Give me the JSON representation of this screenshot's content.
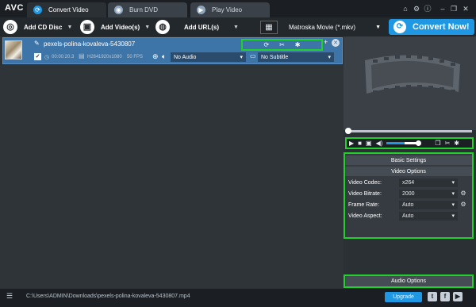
{
  "app": {
    "logo": "AVC"
  },
  "tabs": [
    {
      "label": "Convert Video"
    },
    {
      "label": "Burn DVD"
    },
    {
      "label": "Play Video"
    }
  ],
  "window_buttons": [
    "shop-icon",
    "gear-icon",
    "info-icon",
    "minimize-icon",
    "restore-icon",
    "close-icon"
  ],
  "toolbar": {
    "add_cd": "Add CD Disc",
    "add_video": "Add Video(s)",
    "add_url": "Add URL(s)",
    "format": "Matroska Movie (*.mkv)",
    "convert": "Convert Now!"
  },
  "file": {
    "name": "pexels-polina-kovaleva-5430807",
    "duration": "00:00:20.3",
    "codec": "H264",
    "resolution": "1920x1080",
    "fps": "50 FPS",
    "audio": "No Audio",
    "subtitle": "No Subtitle"
  },
  "player": {
    "volume_percent": 60
  },
  "settings": {
    "basic_header": "Basic Settings",
    "video_header": "Video Options",
    "rows": [
      {
        "label": "Video Codec:",
        "value": "x264"
      },
      {
        "label": "Video Bitrate:",
        "value": "2000"
      },
      {
        "label": "Frame Rate:",
        "value": "Auto"
      },
      {
        "label": "Video Aspect:",
        "value": "Auto"
      }
    ],
    "audio_header": "Audio Options"
  },
  "status": {
    "path": "C:\\Users\\ADMIN\\Downloads\\pexels-polina-kovaleva-5430807.mp4",
    "upgrade": "Upgrade"
  },
  "colors": {
    "accent": "#1f97e3",
    "highlight": "#22d02c",
    "selected_row": "#3d75a8"
  }
}
